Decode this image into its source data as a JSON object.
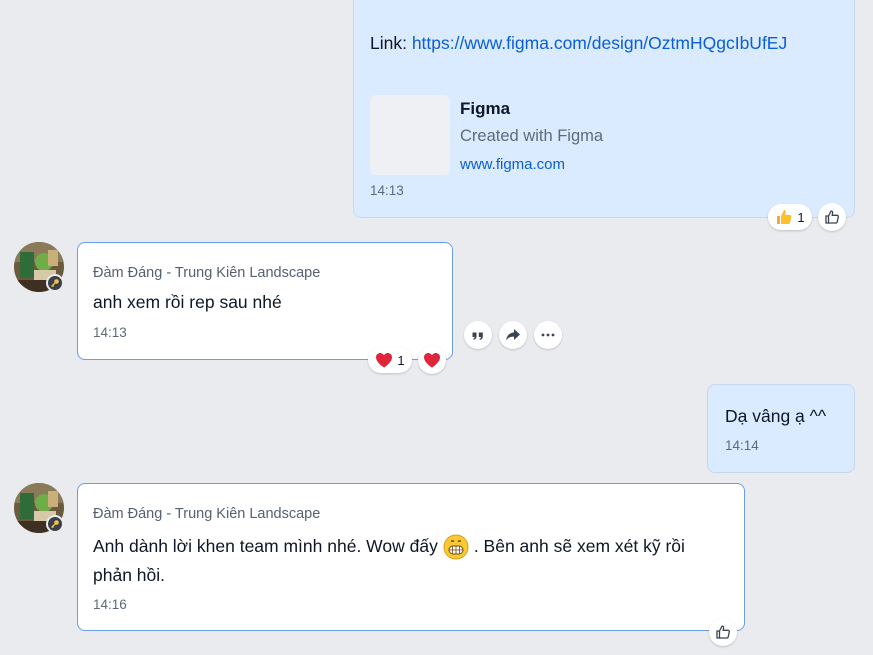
{
  "messages": {
    "m1": {
      "link_prefix": "Link: ",
      "link_url": "https://www.figma.com/design/OztmHQgcIbUfEJ",
      "preview": {
        "title": "Figma",
        "description": "Created with Figma",
        "domain": "www.figma.com"
      },
      "time": "14:13",
      "reaction_count": "1",
      "reaction_icon": "thumbs-up-emoji"
    },
    "m2": {
      "sender": "Đàm Đáng - Trung Kiên Landscape",
      "text": "anh xem rồi rep sau nhé",
      "time": "14:13",
      "reaction_count": "1",
      "reaction_icon": "heart-emoji"
    },
    "m3": {
      "text": "Dạ vâng ạ ^^",
      "time": "14:14"
    },
    "m4": {
      "sender": "Đàm Đáng - Trung Kiên Landscape",
      "text_before_emoji": "Anh dành lời khen team mình nhé. Wow đấy",
      "text_after_emoji": ". Bên anh sẽ xem xét kỹ rồi",
      "text_line2": "phản hồi.",
      "emoji": "grinning-face-emoji",
      "time": "14:16"
    }
  },
  "actions": {
    "icons": [
      "quote-icon",
      "forward-icon",
      "more-icon"
    ]
  },
  "colors": {
    "background": "#e9ebef",
    "my_bubble": "#dbebff",
    "their_bubble_border": "#6b9ce6",
    "link": "#0a5fd6",
    "heart": "#e0253a"
  }
}
